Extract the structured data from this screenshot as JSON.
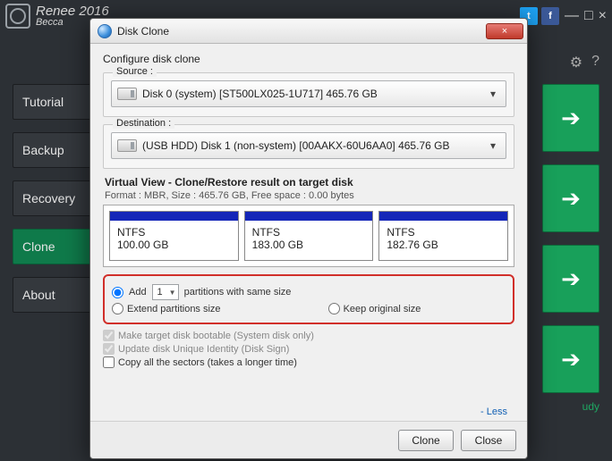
{
  "app": {
    "title_line1": "Renee 2016",
    "title_line2": "Becca",
    "window_controls": {
      "min": "—",
      "max": "□",
      "close": "×"
    },
    "social": {
      "twitter": "t",
      "facebook": "f"
    }
  },
  "sidebar": {
    "items": [
      {
        "label": "Tutorial"
      },
      {
        "label": "Backup"
      },
      {
        "label": "Recovery"
      },
      {
        "label": "Clone"
      },
      {
        "label": "About"
      }
    ]
  },
  "bottom_hint": "udy",
  "dialog": {
    "title": "Disk Clone",
    "close_glyph": "×",
    "subtitle": "Configure disk clone",
    "source": {
      "legend": "Source :",
      "text": "Disk 0 (system) [ST500LX025-1U717]    465.76 GB"
    },
    "destination": {
      "legend": "Destination :",
      "text": "(USB HDD) Disk 1 (non-system) [00AAKX-60U6AA0]    465.76 GB"
    },
    "virtual_view": {
      "title": "Virtual View - Clone/Restore result on target disk",
      "format_line": "Format : MBR,   Size : 465.76 GB,   Free space :   0.00 bytes",
      "partitions": [
        {
          "type": "NTFS",
          "size": "100.00 GB"
        },
        {
          "type": "NTFS",
          "size": "183.00 GB"
        },
        {
          "type": "NTFS",
          "size": "182.76 GB"
        }
      ]
    },
    "options": {
      "add_label_pre": "Add",
      "add_count": "1",
      "add_label_post": "partitions with same size",
      "extend_label": "Extend partitions size",
      "keep_label": "Keep original size",
      "selected": "add"
    },
    "checkboxes": {
      "bootable": {
        "label": "Make target disk bootable (System disk only)",
        "checked": true,
        "disabled": true
      },
      "uid": {
        "label": "Update disk Unique Identity (Disk Sign)",
        "checked": true,
        "disabled": true
      },
      "sectors": {
        "label": "Copy all the sectors (takes a longer time)",
        "checked": false,
        "disabled": false
      }
    },
    "less_link": "- Less",
    "buttons": {
      "clone": "Clone",
      "close": "Close"
    }
  }
}
